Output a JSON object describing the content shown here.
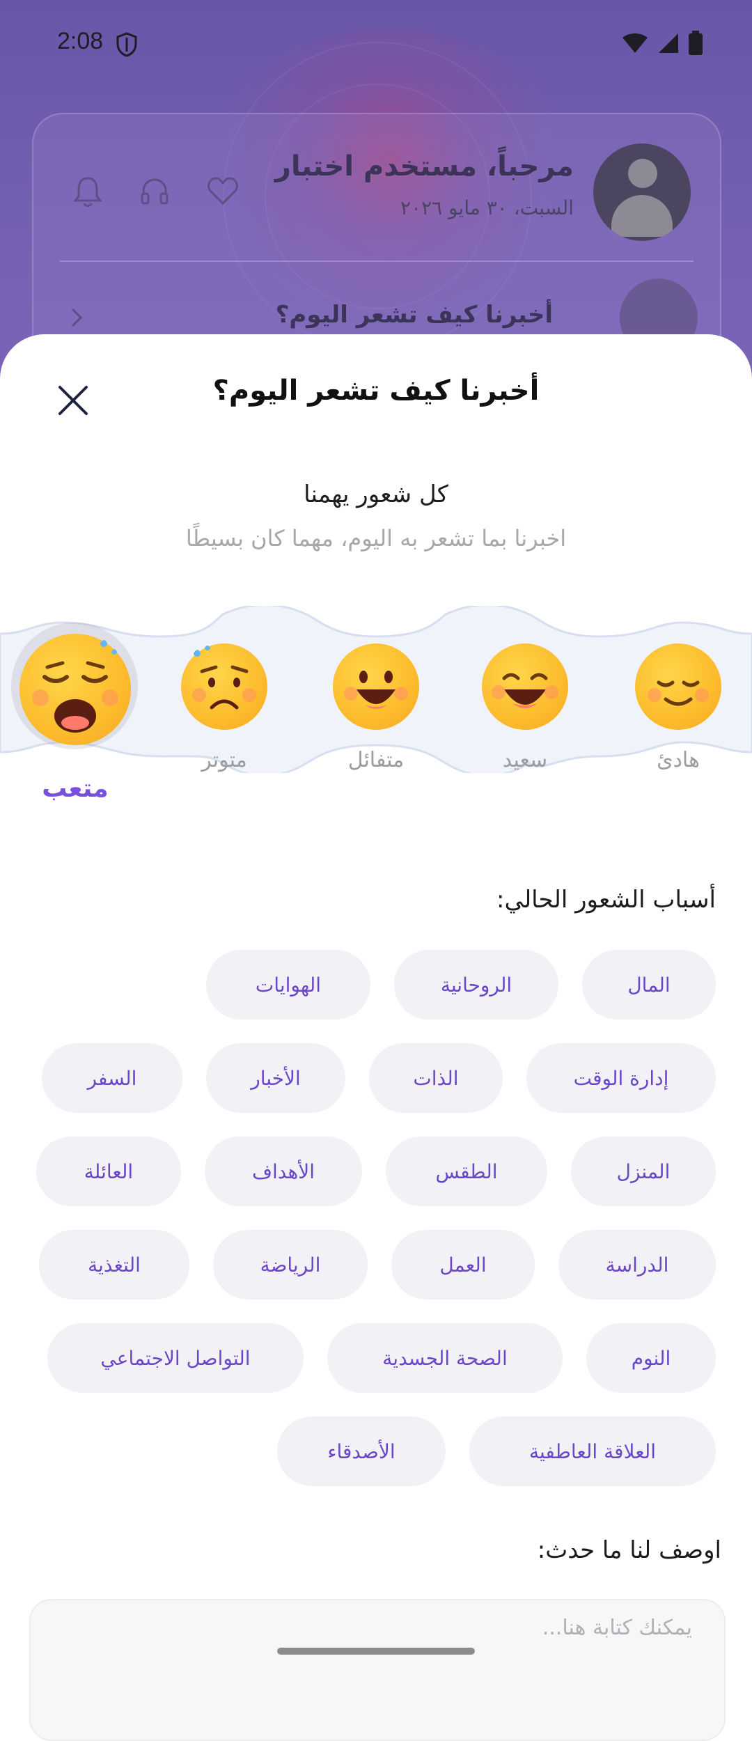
{
  "status_bar": {
    "time": "2:08"
  },
  "home": {
    "greeting": "مرحباً، مستخدم اختبار",
    "date": "السبت، ٣٠ مايو ٢٠٢٦",
    "mood_prompt": "أخبرنا كيف تشعر اليوم؟",
    "icons": [
      "bell-icon",
      "headset-icon",
      "heart-icon",
      "chevron-left-icon"
    ]
  },
  "sheet": {
    "title": "أخبرنا كيف تشعر اليوم؟",
    "subtitle": "كل شعور يهمنا",
    "subtext": "اخبرنا بما تشعر به اليوم، مهما كان بسيطًا"
  },
  "moods": {
    "items": [
      {
        "label": "هادئ",
        "icon": "calm-face-icon"
      },
      {
        "label": "سعيد",
        "icon": "happy-face-icon"
      },
      {
        "label": "متفائل",
        "icon": "optimistic-face-icon"
      },
      {
        "label": "متوتر",
        "icon": "anxious-face-icon"
      },
      {
        "label": "متعب",
        "icon": "tired-face-icon"
      }
    ],
    "selected_label": "متعب"
  },
  "reasons": {
    "title": "أسباب الشعور الحالي:",
    "chips": [
      "المال",
      "الروحانية",
      "الهوايات",
      "إدارة الوقت",
      "الذات",
      "الأخبار",
      "السفر",
      "المنزل",
      "الطقس",
      "الأهداف",
      "العائلة",
      "الدراسة",
      "العمل",
      "الرياضة",
      "التغذية",
      "النوم",
      "الصحة الجسدية",
      "التواصل الاجتماعي",
      "العلاقة العاطفية",
      "الأصدقاء"
    ]
  },
  "describe": {
    "title": "اوصف لنا ما حدث:",
    "placeholder": "يمكنك كتابة هنا..."
  },
  "colors": {
    "accent": "#7a4fe0",
    "chip_bg": "#f1f1f6",
    "chip_text": "#6a46c8"
  }
}
